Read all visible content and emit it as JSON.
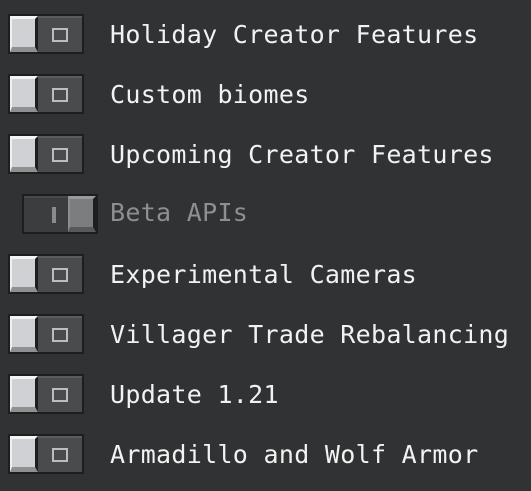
{
  "experiments": [
    {
      "label": "Holiday Creator Features",
      "enabled": false,
      "disabled": false
    },
    {
      "label": "Custom biomes",
      "enabled": false,
      "disabled": false
    },
    {
      "label": "Upcoming Creator Features",
      "enabled": false,
      "disabled": false
    },
    {
      "label": "Beta APIs",
      "enabled": true,
      "disabled": true
    },
    {
      "label": "Experimental Cameras",
      "enabled": false,
      "disabled": false
    },
    {
      "label": "Villager Trade Rebalancing",
      "enabled": false,
      "disabled": false
    },
    {
      "label": "Update 1.21",
      "enabled": false,
      "disabled": false
    },
    {
      "label": "Armadillo and Wolf Armor",
      "enabled": false,
      "disabled": false
    }
  ],
  "colors": {
    "background": "#313233",
    "label": "#f2f2f2",
    "label_disabled": "#8e8f90"
  }
}
